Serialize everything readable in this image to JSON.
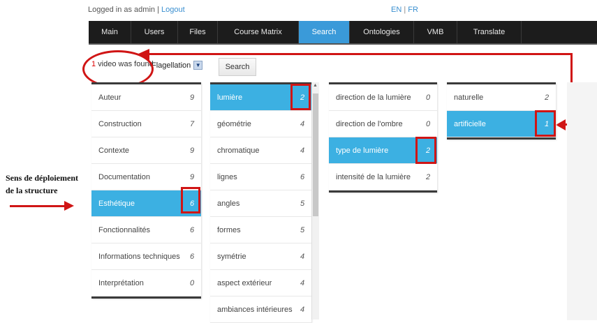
{
  "header": {
    "logged_text": "Logged in as admin | ",
    "logout": "Logout",
    "lang_en": "EN",
    "lang_sep": " | ",
    "lang_fr": "FR"
  },
  "nav": {
    "tabs": [
      {
        "label": "Main"
      },
      {
        "label": "Users"
      },
      {
        "label": "Files"
      },
      {
        "label": "Course Matrix"
      },
      {
        "label": "Search"
      },
      {
        "label": "Ontologies"
      },
      {
        "label": "VMB"
      },
      {
        "label": "Translate"
      }
    ],
    "active": "Search"
  },
  "search": {
    "found_count": "1",
    "found_text": " video was found",
    "select_value": "Flagellation",
    "button_label": "Search"
  },
  "columns": [
    {
      "items": [
        {
          "label": "Auteur",
          "count": "9"
        },
        {
          "label": "Construction",
          "count": "7"
        },
        {
          "label": "Contexte",
          "count": "9"
        },
        {
          "label": "Documentation",
          "count": "9"
        },
        {
          "label": "Esthétique",
          "count": "6"
        },
        {
          "label": "Fonctionnalités",
          "count": "6"
        },
        {
          "label": "Informations techniques",
          "count": "6"
        },
        {
          "label": "Interprétation",
          "count": "0"
        }
      ]
    },
    {
      "items": [
        {
          "label": "lumière",
          "count": "2"
        },
        {
          "label": "géométrie",
          "count": "4"
        },
        {
          "label": "chromatique",
          "count": "4"
        },
        {
          "label": "lignes",
          "count": "6"
        },
        {
          "label": "angles",
          "count": "5"
        },
        {
          "label": "formes",
          "count": "5"
        },
        {
          "label": "symétrie",
          "count": "4"
        },
        {
          "label": "aspect extérieur",
          "count": "4"
        },
        {
          "label": "ambiances intérieures",
          "count": "4"
        }
      ]
    },
    {
      "items": [
        {
          "label": "direction de la lumière",
          "count": "0"
        },
        {
          "label": "direction de l'ombre",
          "count": "0"
        },
        {
          "label": "type de lumière",
          "count": "2"
        },
        {
          "label": "intensité de la lumière",
          "count": "2"
        }
      ]
    },
    {
      "items": [
        {
          "label": "naturelle",
          "count": "2"
        },
        {
          "label": "artificielle",
          "count": "1"
        }
      ]
    }
  ],
  "annotation": {
    "line1": "Sens de déploiement",
    "line2": " de la structure"
  },
  "colors": {
    "accent": "#3a9ad9",
    "selected": "#3cb0e2",
    "highlight": "#d01515",
    "navbar": "#1c1c1c"
  }
}
